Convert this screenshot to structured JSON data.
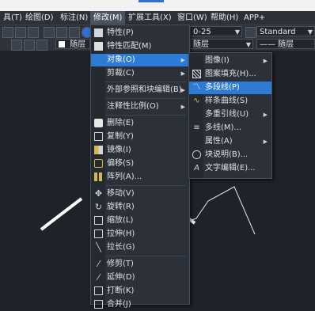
{
  "menubar": [
    {
      "label": "具(T)"
    },
    {
      "label": "绘图(D)"
    },
    {
      "label": "标注(N)"
    },
    {
      "label": "修改(M)"
    },
    {
      "label": "扩展工具(X)"
    },
    {
      "label": "窗口(W)"
    },
    {
      "label": "帮助(H)"
    },
    {
      "label": "APP+"
    }
  ],
  "toolbar": {
    "dimstyle_value": "0-25",
    "textstyle_value": "Standard",
    "layer_value": "随层",
    "linetype_value": "随层",
    "lineweight_value": "—— 随层"
  },
  "modify_menu": {
    "items": [
      {
        "label": "特性(P)"
      },
      {
        "label": "特性匹配(M)"
      },
      {
        "label": "对象(O)"
      },
      {
        "label": "剪裁(C)"
      },
      {
        "label": "外部参照和块编辑(B)"
      },
      {
        "label": "注释性比例(O)"
      },
      {
        "label": "删除(E)"
      },
      {
        "label": "复制(Y)"
      },
      {
        "label": "镜像(I)"
      },
      {
        "label": "偏移(S)"
      },
      {
        "label": "阵列(A)..."
      },
      {
        "label": "移动(V)"
      },
      {
        "label": "旋转(R)"
      },
      {
        "label": "缩放(L)"
      },
      {
        "label": "拉伸(H)"
      },
      {
        "label": "拉长(G)"
      },
      {
        "label": "修剪(T)"
      },
      {
        "label": "延伸(D)"
      },
      {
        "label": "打断(K)"
      },
      {
        "label": "合并(J)"
      }
    ]
  },
  "object_submenu": {
    "items": [
      {
        "label": "图像(I)"
      },
      {
        "label": "图案填充(H)..."
      },
      {
        "label": "多段线(P)"
      },
      {
        "label": "样条曲线(S)"
      },
      {
        "label": "多重引线(U)"
      },
      {
        "label": "多线(M)..."
      },
      {
        "label": "属性(A)"
      },
      {
        "label": "块说明(B)..."
      },
      {
        "label": "文字编辑(E)..."
      }
    ]
  },
  "colors": {
    "highlight": "#2d7bd4",
    "menu_bg": "#2b3039",
    "canvas_bg": "#1e2229"
  }
}
